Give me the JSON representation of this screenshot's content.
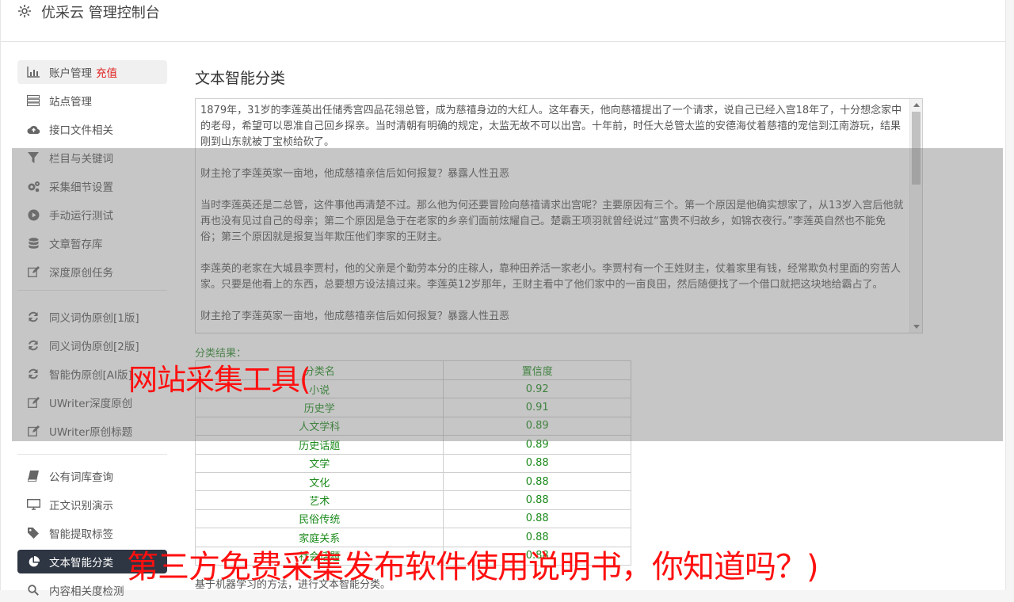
{
  "header": {
    "title": "优采云 管理控制台",
    "icon": "gear-icon"
  },
  "sidebar": {
    "group1": [
      {
        "label": "账户管理",
        "badge": "充值",
        "icon": "bar-chart-icon"
      },
      {
        "label": "站点管理",
        "icon": "server-icon"
      },
      {
        "label": "接口文件相关",
        "icon": "cloud-upload-icon"
      },
      {
        "label": "栏目与关键词",
        "icon": "filter-icon"
      },
      {
        "label": "采集细节设置",
        "icon": "gears-icon"
      },
      {
        "label": "手动运行测试",
        "icon": "play-circle-icon"
      },
      {
        "label": "文章暂存库",
        "icon": "database-icon"
      },
      {
        "label": "深度原创任务",
        "icon": "edit-icon"
      }
    ],
    "group2": [
      {
        "label": "同义词伪原创[1版]",
        "icon": "refresh-icon"
      },
      {
        "label": "同义词伪原创[2版]",
        "icon": "refresh-icon"
      },
      {
        "label": "智能伪原创[AI版]",
        "icon": "refresh-icon"
      },
      {
        "label": "UWriter深度原创",
        "icon": "edit-icon"
      },
      {
        "label": "UWriter原创标题",
        "icon": "edit-icon"
      }
    ],
    "group3": [
      {
        "label": "公有词库查询",
        "icon": "book-icon"
      },
      {
        "label": "正文识别演示",
        "icon": "desktop-icon"
      },
      {
        "label": "智能提取标签",
        "icon": "tag-icon"
      },
      {
        "label": "文本智能分类",
        "icon": "pie-chart-icon"
      },
      {
        "label": "内容相关度检测",
        "icon": "search-icon"
      }
    ]
  },
  "main": {
    "title": "文本智能分类",
    "text_paragraphs": [
      "1879年，31岁的李莲英出任储秀宫四品花翎总管，成为慈禧身边的大红人。这年春天，他向慈禧提出了一个请求，说自己已经入宫18年了，十分想念家中的老母，希望可以恩准自己回乡探亲。当时清朝有明确的规定，太监无故不可以出宫。十年前，时任大总管太监的安德海仗着慈禧的宠信到江南游玩，结果刚到山东就被丁宝桢给砍了。",
      "财主抢了李莲英家一亩地，他成慈禧亲信后如何报复？暴露人性丑恶",
      "当时李莲英还是二总管，这件事他再清楚不过。那么他为何还要冒险向慈禧请求出宫呢？主要原因有三个。第一个原因是他确实想家了，从13岁入宫后他就再也没有见过自己的母亲；第二个原因是急于在老家的乡亲们面前炫耀自己。楚霸王项羽就曾经说过“富贵不归故乡，如锦衣夜行。”李莲英自然也不能免俗；第三个原因就是报复当年欺压他们李家的王财主。",
      "李莲英的老家在大城县李贾村，他的父亲是个勤劳本分的庄稼人，靠种田养活一家老小。李贾村有一个王姓财主，仗着家里有钱，经常欺负村里面的穷苦人家。只要是他看上的东西，总要想方设法搞过来。李莲英12岁那年，王财主看中了他们家中的一亩良田，然后随便找了一个借口就把这块地给霸占了。",
      "财主抢了李莲英家一亩地，他成慈禧亲信后如何报复？暴露人性丑恶"
    ],
    "result_label": "分类结果：",
    "table_headers": [
      "分类名",
      "置信度"
    ],
    "rows": [
      [
        "小说",
        "0.92"
      ],
      [
        "历史学",
        "0.91"
      ],
      [
        "人文学科",
        "0.89"
      ],
      [
        "历史话题",
        "0.89"
      ],
      [
        "文学",
        "0.88"
      ],
      [
        "文化",
        "0.88"
      ],
      [
        "艺术",
        "0.88"
      ],
      [
        "民俗传统",
        "0.88"
      ],
      [
        "家庭关系",
        "0.88"
      ],
      [
        "社会话题",
        "0.88"
      ]
    ],
    "description": "基于机器学习的方法，进行文本智能分类。"
  },
  "overlay": {
    "caption_top": "网站采集工具(",
    "caption_bottom": "第三方免费采集发布软件使用说明书，你知道吗？)"
  },
  "colors": {
    "accent_green": "#1b8a1b",
    "active_bg": "#2e3643",
    "caption_red": "#ff1010",
    "badge_red": "#e02020"
  }
}
